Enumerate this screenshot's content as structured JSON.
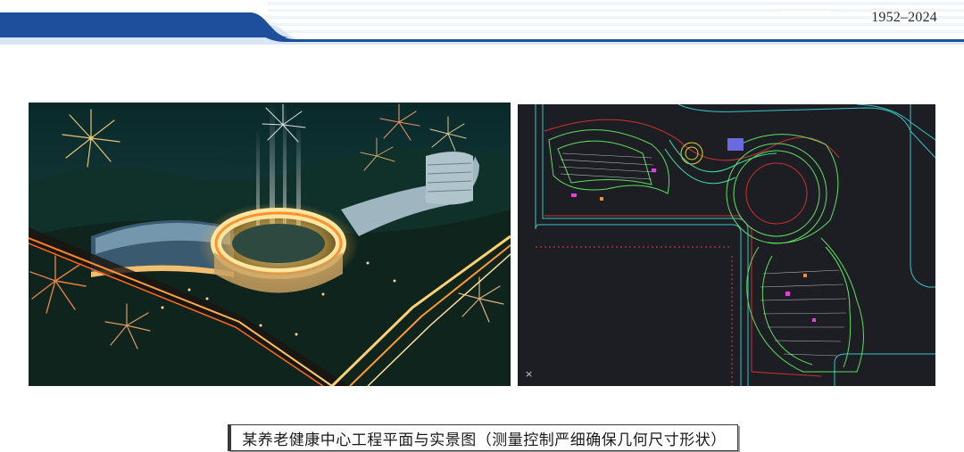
{
  "header": {
    "years": "1952–2024",
    "colors": {
      "band": "#1d4f9c",
      "light": "#d9e6f5",
      "stripe": "#eef4fb"
    }
  },
  "photos": {
    "rendering_icon": "aerial-night-rendering-image",
    "plan_icon": "cad-site-plan-image",
    "plan_corner_mark": "×"
  },
  "caption": {
    "text": "某养老健康中心工程平面与实景图（测量控制严细确保几何尺寸形状）"
  }
}
